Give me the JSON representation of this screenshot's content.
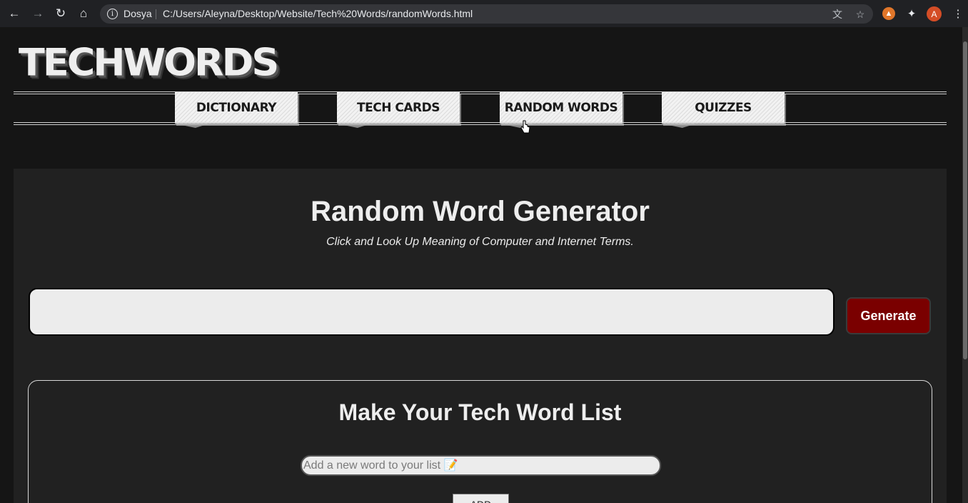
{
  "browser": {
    "site_label": "Dosya",
    "url": "C:/Users/Aleyna/Desktop/Website/Tech%20Words/randomWords.html",
    "profile_initial": "A",
    "icons": [
      "back-icon",
      "forward-icon",
      "reload-icon",
      "home-icon",
      "info-icon",
      "translate-icon",
      "star-icon",
      "brave-icon",
      "extensions-icon",
      "menu-icon"
    ]
  },
  "site": {
    "logo": "TECHWORDS",
    "nav": [
      {
        "label": "DICTIONARY"
      },
      {
        "label": "TECH CARDS"
      },
      {
        "label": "RANDOM WORDS"
      },
      {
        "label": "QUIZZES"
      }
    ]
  },
  "generator": {
    "title": "Random Word Generator",
    "subtitle": "Click and Look Up Meaning of Computer and Internet Terms.",
    "output_value": "",
    "button_label": "Generate"
  },
  "word_list": {
    "title": "Make Your Tech Word List",
    "input_placeholder": "Add a new word to your list 📝",
    "add_label": "ADD"
  },
  "colors": {
    "page_bg": "#151515",
    "panel_bg": "#212121",
    "generate_button": "#7a0000"
  }
}
